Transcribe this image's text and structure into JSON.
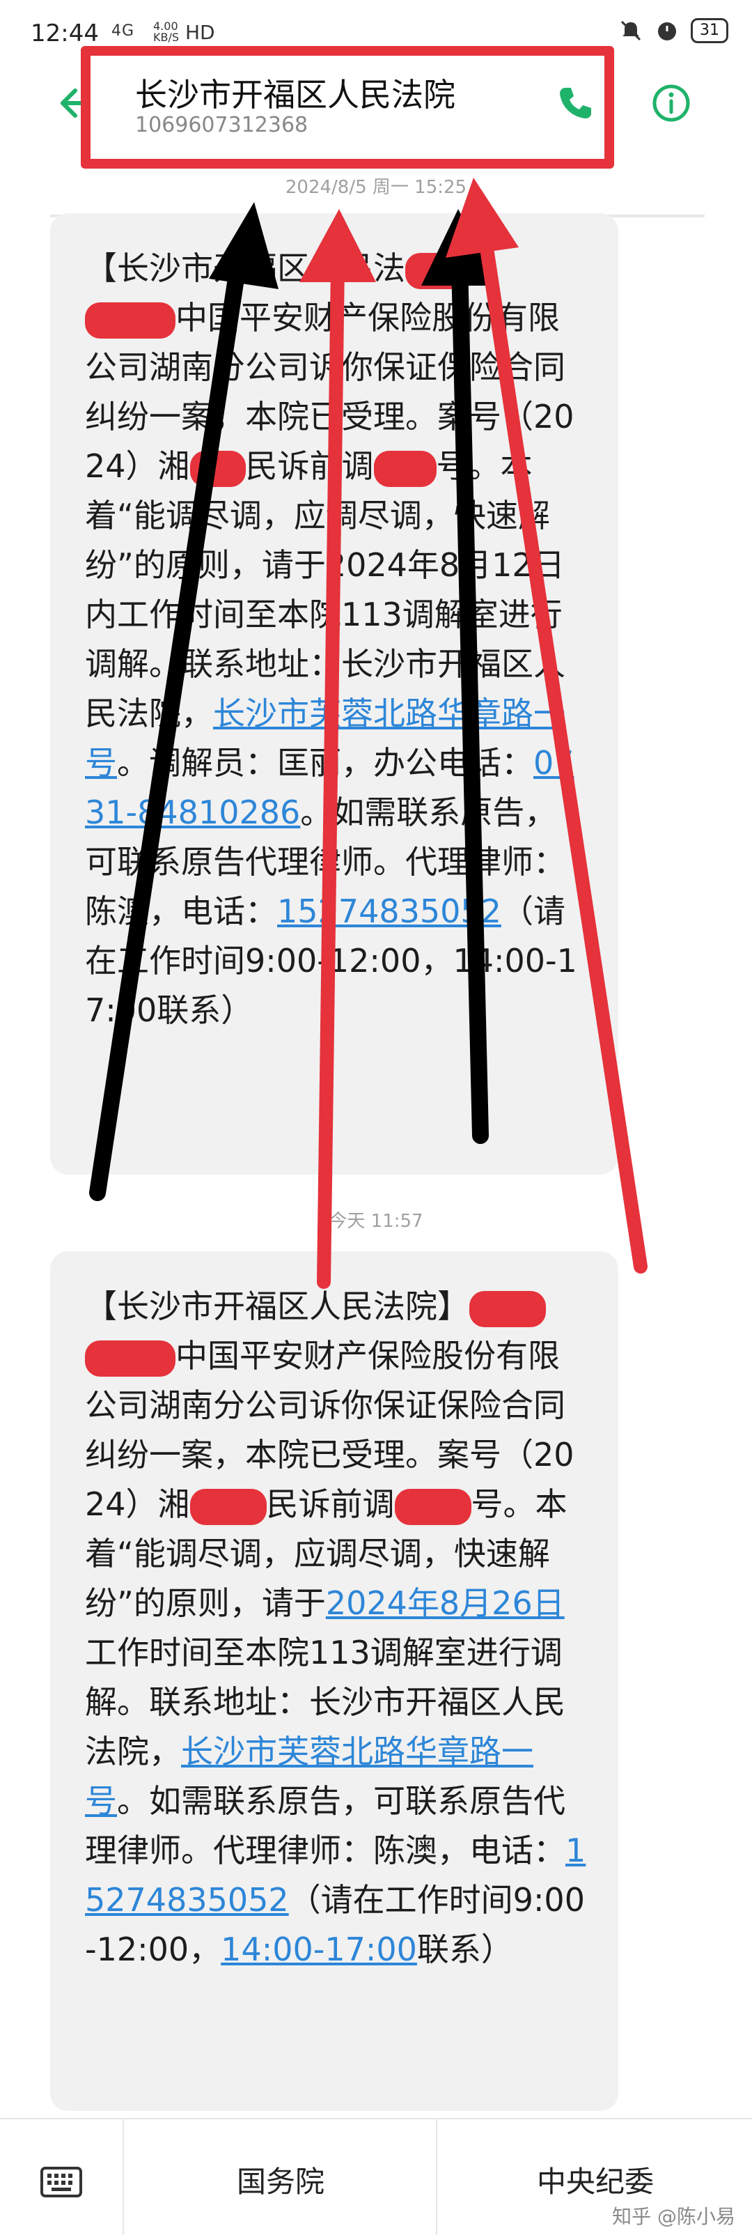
{
  "status_bar": {
    "time": "12:44",
    "network": "4G",
    "speed_value": "4.00",
    "speed_unit": "KB/S",
    "hd": "HD",
    "battery": "31"
  },
  "header": {
    "contact_name": "长沙市开福区人民法院",
    "contact_number": "1069607312368"
  },
  "messages": [
    {
      "timestamp": "2024/8/5 周一 15:25",
      "segments": [
        "【长沙市开福区人民法",
        "中国平安财产保险股份有限公司湖南分公司诉你保证保险合同纠纷一案，本院已受理。案号（2024）湘",
        "民诉前调",
        "号。本着“能调尽调，应调尽调，快速解纷”的原则，请于2024年8月12日内工作时间至本院113调解室进行调解。联系地址：长沙市开福区人民法院，",
        "长沙市芙蓉北路华章路一号",
        "。调解员：匡丽，办公电话：",
        "0731-84810286",
        "。如需联系原告，可联系原告代理律师。代理律师：陈澳，电话：",
        "15274835052",
        "（请在工作时间9:00-12:00，14:00-17:00联系）"
      ]
    },
    {
      "timestamp": "今天 11:57",
      "segments": [
        "【长沙市开福区人民法院】",
        "中国平安财产保险股份有限公司湖南分公司诉你保证保险合同纠纷一案，本院已受理。案号（2024）湘",
        "民诉前调",
        "号。本着“能调尽调，应调尽调，快速解纷”的原则，请于",
        "2024年8月26日",
        "工作时间至本院113调解室进行调解。联系地址：长沙市开福区人民法院，",
        "长沙市芙蓉北路华章路一号",
        "。如需联系原告，可联系原告代理律师。代理律师：陈澳，电话：",
        "15274835052",
        "（请在工作时间9:00-12:00，",
        "14:00-17:00",
        "联系）"
      ]
    }
  ],
  "bottom_bar": {
    "menu_1": "国务院",
    "menu_2": "中央纪委",
    "watermark": "知乎 @陈小易"
  },
  "colors": {
    "annotation_red": "#e5323b",
    "annotation_black": "#000000",
    "link_blue": "#2d86d8",
    "accent_green": "#1fb26b"
  },
  "icons": [
    "back-arrow-icon",
    "phone-icon",
    "info-icon",
    "keyboard-icon"
  ]
}
